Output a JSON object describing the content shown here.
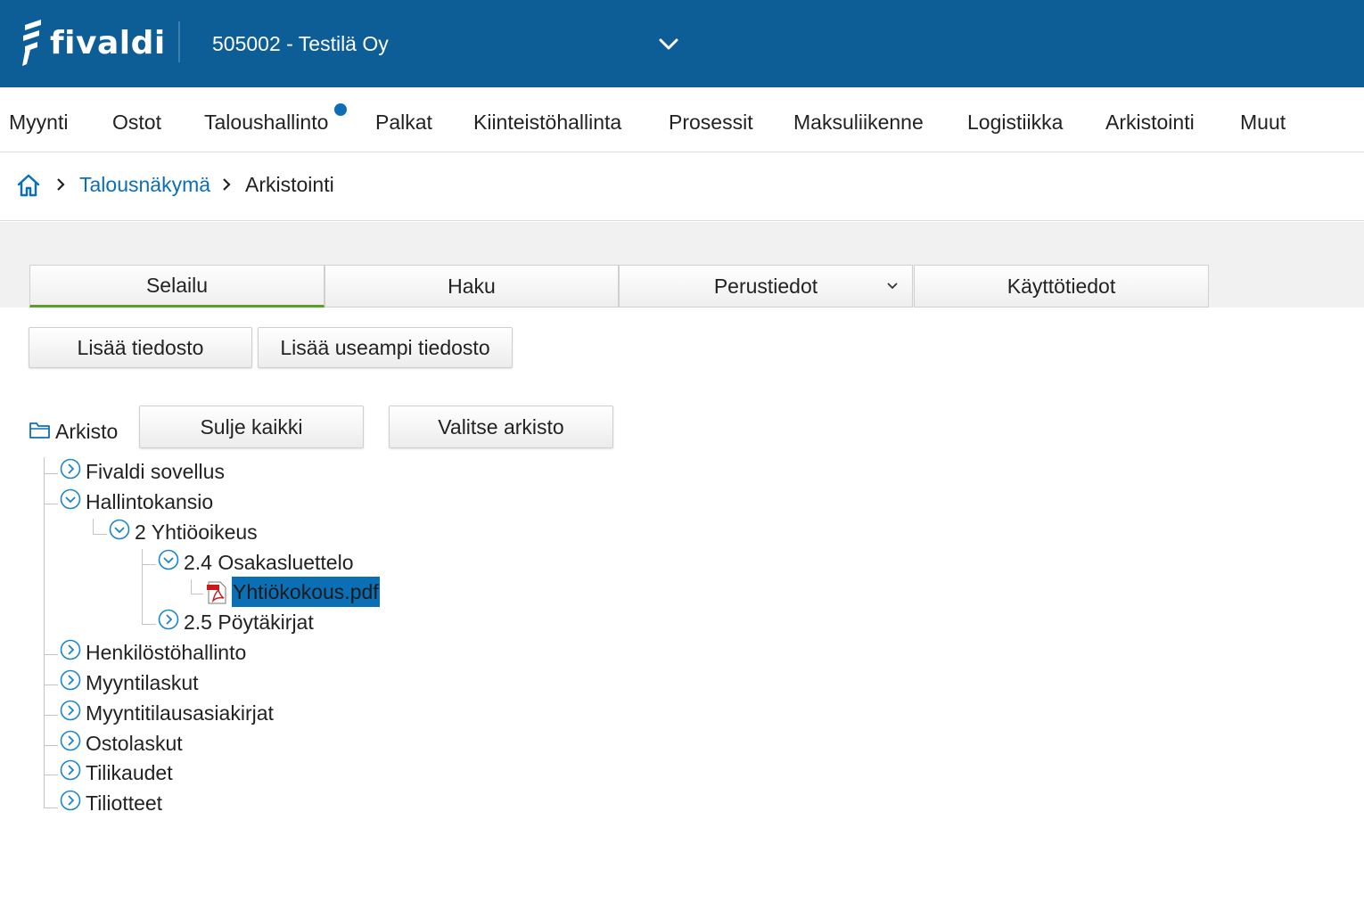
{
  "header": {
    "logo_text": "fivaldi",
    "company": "505002 - Testilä Oy"
  },
  "nav": {
    "items": [
      "Myynti",
      "Ostot",
      "Taloushallinto",
      "Palkat",
      "Kiinteistöhallinta",
      "Prosessit",
      "Maksuliikenne",
      "Logistiikka",
      "Arkistointi",
      "Muut"
    ],
    "notification_on": "Taloushallinto"
  },
  "breadcrumb": {
    "link": "Talousnäkymä",
    "current": "Arkistointi"
  },
  "tabs": {
    "selailu": "Selailu",
    "haku": "Haku",
    "perustiedot": "Perustiedot",
    "kayttotiedot": "Käyttötiedot",
    "active": "Selailu"
  },
  "actions": {
    "add_file": "Lisää tiedosto",
    "add_multiple": "Lisää useampi tiedosto",
    "close_all": "Sulje kaikki",
    "select_archive": "Valitse arkisto"
  },
  "tree": {
    "root": "Arkisto",
    "fivaldi_sovellus": "Fivaldi sovellus",
    "hallintokansio": "Hallintokansio",
    "yhtiooikeus": "2 Yhtiöoikeus",
    "osakasluettelo": "2.4 Osakasluettelo",
    "file": "Yhtiökokous.pdf",
    "poytakirjat": "2.5 Pöytäkirjat",
    "henkilostohallinto": "Henkilöstöhallinto",
    "myyntilaskut": "Myyntilaskut",
    "myyntitilaus": "Myyntitilausasiakirjat",
    "ostolaskut": "Ostolaskut",
    "tilikaudet": "Tilikaudet",
    "tiliotteet": "Tiliotteet"
  },
  "colors": {
    "header_bg": "#0d5d96",
    "link": "#0d6eb8",
    "active_tab_underline": "#5a9e2a",
    "selection": "#0b6fb5"
  }
}
